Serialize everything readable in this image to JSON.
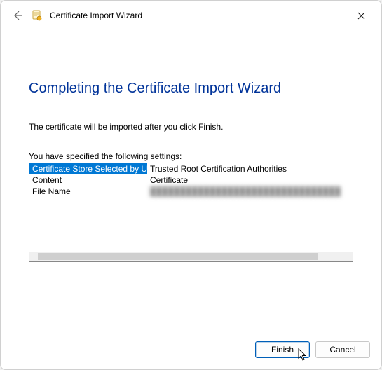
{
  "window": {
    "title": "Certificate Import Wizard"
  },
  "heading": "Completing the Certificate Import Wizard",
  "description": "The certificate will be imported after you click Finish.",
  "settings_label": "You have specified the following settings:",
  "rows": [
    {
      "key": "Certificate Store Selected by User",
      "value": "Trusted Root Certification Authorities"
    },
    {
      "key": "Content",
      "value": "Certificate"
    },
    {
      "key": "File Name",
      "value": "████████████████████████████████"
    }
  ],
  "buttons": {
    "finish": "Finish",
    "cancel": "Cancel"
  }
}
